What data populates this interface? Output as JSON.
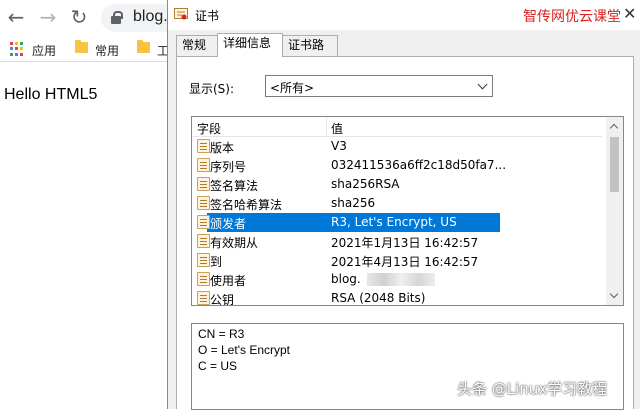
{
  "browser": {
    "url": "blog.",
    "bookmarks": [
      {
        "label": "应用"
      },
      {
        "label": "常用"
      },
      {
        "label": "工"
      }
    ],
    "page_text": "Hello HTML5",
    "apps_colors": [
      "#ea4335",
      "#fbbc05",
      "#34a853",
      "#4285f4",
      "#ea4335",
      "#fbbc05",
      "#34a853",
      "#4285f4",
      "#ea4335"
    ]
  },
  "dialog": {
    "title": "证书",
    "watermark": "智传网优云课堂",
    "tabs": [
      {
        "label": "常规"
      },
      {
        "label": "详细信息"
      },
      {
        "label": "证书路径"
      }
    ],
    "show_label": "显示(S):",
    "show_value": "<所有>",
    "columns": {
      "field": "字段",
      "value": "值"
    },
    "rows": [
      {
        "field": "版本",
        "value": "V3"
      },
      {
        "field": "序列号",
        "value": "032411536a6ff2c18d50fa7..."
      },
      {
        "field": "签名算法",
        "value": "sha256RSA"
      },
      {
        "field": "签名哈希算法",
        "value": "sha256"
      },
      {
        "field": "颁发者",
        "value": "R3, Let's Encrypt, US"
      },
      {
        "field": "有效期从",
        "value": "2021年1月13日 16:42:57"
      },
      {
        "field": "到",
        "value": "2021年4月13日 16:42:57"
      },
      {
        "field": "使用者",
        "value": "blog."
      },
      {
        "field": "公钥",
        "value": "RSA (2048 Bits)"
      }
    ],
    "details": [
      "CN = R3",
      "O = Let's Encrypt",
      "C = US"
    ]
  },
  "overlay": {
    "credit": "头条 @Linux学习教程"
  },
  "colors": {
    "selection": "#0078d7",
    "watermark": "#d9231f"
  }
}
